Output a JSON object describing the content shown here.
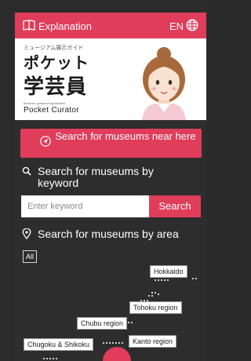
{
  "header": {
    "explanation_label": "Explanation",
    "language_label": "EN",
    "book_icon": "book-icon",
    "globe_icon": "globe-icon"
  },
  "banner": {
    "subtitle": "ミュージアム展示ガイド",
    "title_line1": "ポケット",
    "title_line2": "学芸員",
    "tagline": "Museum guidance Application",
    "product_name": "Pocket Curator"
  },
  "near_search": {
    "label": "Search for museums near here",
    "icon": "navigation-arrow-icon"
  },
  "keyword_search": {
    "title": "Search for museums by keyword",
    "placeholder": "Enter keyword",
    "button_label": "Search",
    "icon": "search-icon"
  },
  "area_search": {
    "title": "Search for museums by area",
    "icon": "location-pin-icon",
    "all_label": "All",
    "regions": [
      "Hokkaido",
      "Tohoku region",
      "Chubu region",
      "Kanto region",
      "Chugoku & Shikoku"
    ]
  },
  "colors": {
    "accent": "#e03d5b",
    "background": "#2d2d2d",
    "map_dots": "#cfcfcf"
  }
}
